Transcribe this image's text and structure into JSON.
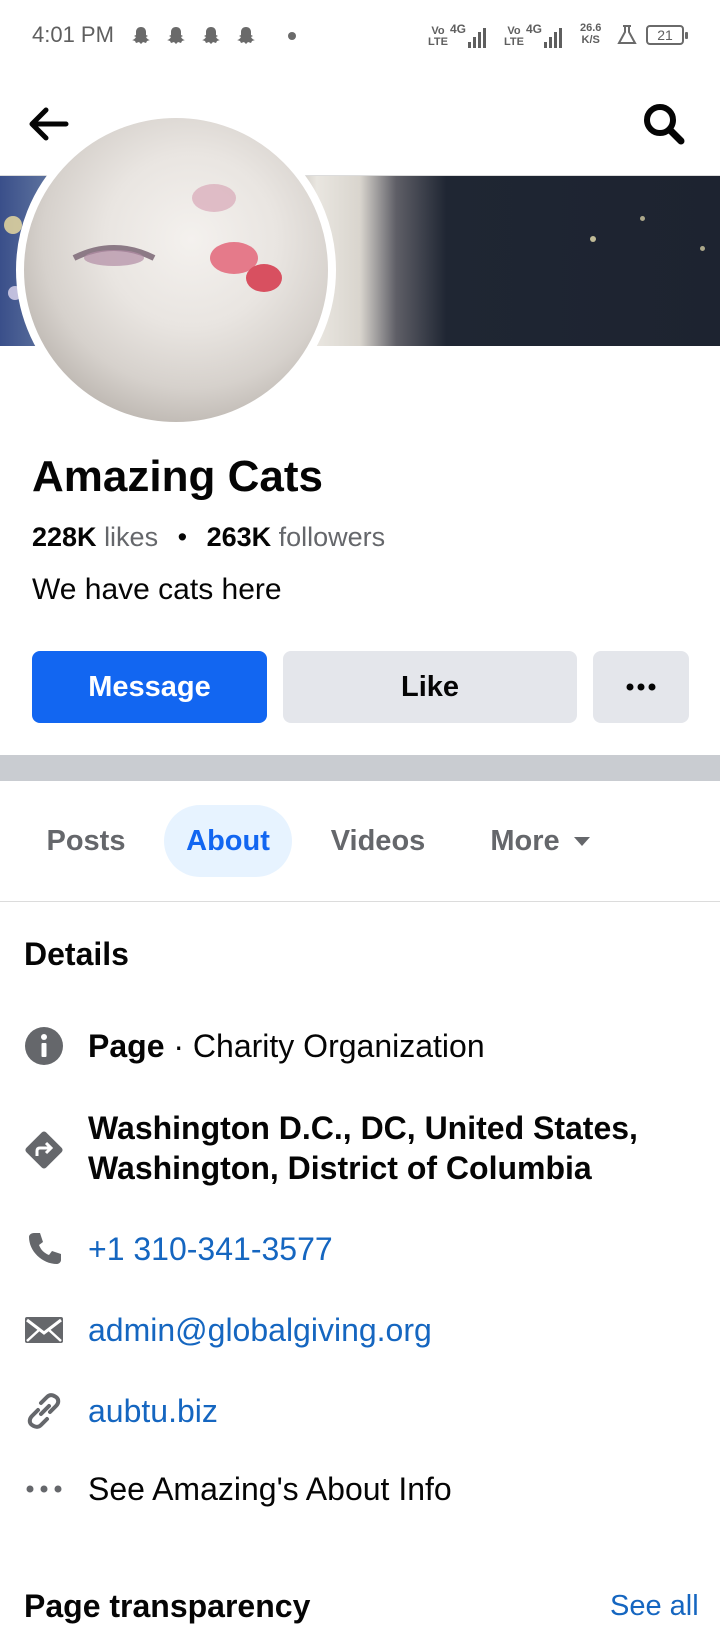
{
  "status_bar": {
    "time": "4:01 PM",
    "volte_1": "Vo LTE",
    "network_1": "4G",
    "volte_2": "Vo LTE",
    "network_2": "4G",
    "speed_value": "26.6",
    "speed_unit": "K/S",
    "battery": "21"
  },
  "app_bar": {
    "back_icon": "arrow-left-icon",
    "search_icon": "search-icon"
  },
  "page": {
    "name": "Amazing Cats",
    "likes_count": "228K",
    "likes_label": "likes",
    "followers_count": "263K",
    "followers_label": "followers",
    "separator": "•",
    "tagline": "We have cats here"
  },
  "actions": {
    "message": "Message",
    "like": "Like",
    "more": "•••"
  },
  "tabs": [
    {
      "label": "Posts",
      "active": false
    },
    {
      "label": "About",
      "active": true
    },
    {
      "label": "Videos",
      "active": false
    },
    {
      "label": "More",
      "active": false
    }
  ],
  "details": {
    "title": "Details",
    "category_prefix": "Page",
    "category_sep": " · ",
    "category": "Charity Organization",
    "address": "Washington D.C., DC, United States, Washington, District of Columbia",
    "phone": "+1 310-341-3577",
    "email": "admin@globalgiving.org",
    "website": "aubtu.biz",
    "see_about": "See Amazing's About Info"
  },
  "transparency": {
    "title": "Page transparency",
    "see_all": "See all"
  },
  "colors": {
    "accent": "#1266f1",
    "link": "#1566c0",
    "tab_active_bg": "#e7f3ff",
    "secondary_button": "#e4e6eb",
    "section_divider": "#c9ccd1"
  }
}
